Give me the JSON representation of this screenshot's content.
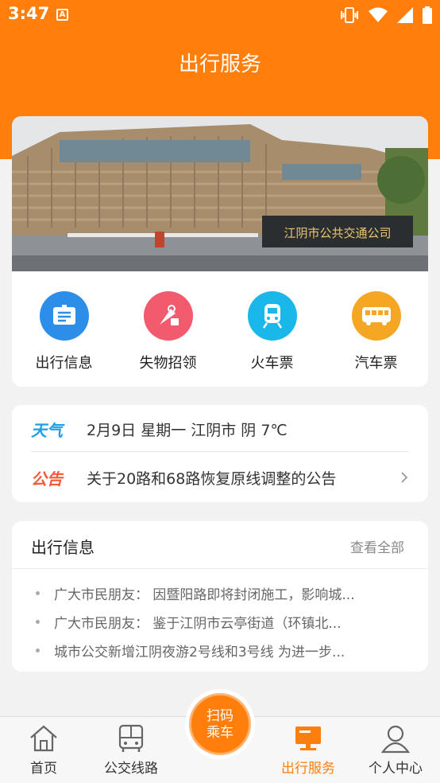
{
  "status": {
    "time": "3:47",
    "notif_letter": "A"
  },
  "header": {
    "title": "出行服务"
  },
  "banner": {
    "sign_text": "江阴市公共交通公司"
  },
  "services": [
    {
      "label": "出行信息",
      "icon": "info-board-icon",
      "color": "#2c8ee8"
    },
    {
      "label": "失物招领",
      "icon": "lost-found-icon",
      "color": "#f25a6e"
    },
    {
      "label": "火车票",
      "icon": "train-icon",
      "color": "#19b7ea"
    },
    {
      "label": "汽车票",
      "icon": "bus-icon",
      "color": "#f5a623"
    }
  ],
  "notices": {
    "weather_tag": "天气",
    "weather_text": "2月9日 星期一 江阴市 阴 7℃",
    "notice_tag": "公告",
    "notice_text": "关于20路和68路恢复原线调整的公告"
  },
  "info": {
    "title": "出行信息",
    "more": "查看全部",
    "items": [
      "广大市民朋友： 因暨阳路即将封闭施工，影响城...",
      " 广大市民朋友： 鉴于江阴市云亭街道（环镇北...",
      "城市公交新增江阴夜游2号线和3号线 为进一步..."
    ]
  },
  "tabbar": {
    "home": "首页",
    "routes": "公交线路",
    "scan_line1": "扫码",
    "scan_line2": "乘车",
    "service": "出行服务",
    "me": "个人中心"
  },
  "colors": {
    "accent": "#ff7e0c"
  }
}
